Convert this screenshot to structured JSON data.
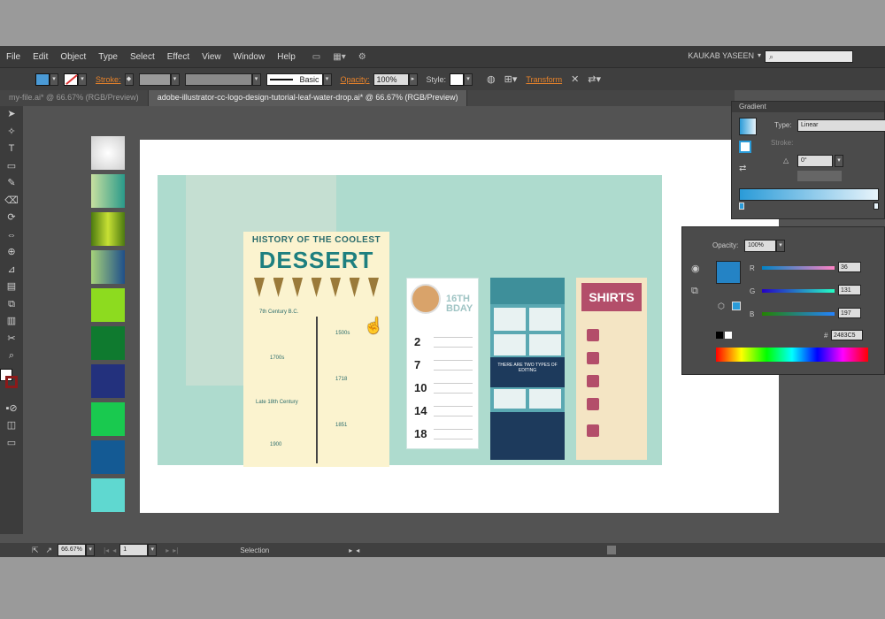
{
  "menu": {
    "items": [
      "File",
      "Edit",
      "Object",
      "Type",
      "Select",
      "Effect",
      "View",
      "Window",
      "Help"
    ],
    "user": "KAUKAB YASEEN",
    "search_placeholder": ""
  },
  "options": {
    "stroke_label": "Stroke:",
    "basic_label": "Basic",
    "opacity_label": "Opacity:",
    "opacity_value": "100%",
    "style_label": "Style:",
    "transform_label": "Transform"
  },
  "tabs": [
    {
      "label": "my-file.ai* @ 66.67% (RGB/Preview)",
      "active": false
    },
    {
      "label": "adobe-illustrator-cc-logo-design-tutorial-leaf-water-drop.ai* @ 66.67% (RGB/Preview)",
      "active": true
    }
  ],
  "tools": [
    "selection-tool",
    "direct-selection-tool",
    "type-tool",
    "rectangle-tool",
    "pen-tool",
    "pencil-tool",
    "rotate-tool",
    "scale-tool",
    "width-tool",
    "free-transform-tool",
    "shape-builder-tool",
    "perspective-tool",
    "mesh-tool",
    "gradient-tool",
    "eyedropper-tool",
    "blend-tool",
    "symbol-tool",
    "graph-tool",
    "artboard-tool",
    "slice-tool",
    "hand-tool",
    "zoom-tool"
  ],
  "swatches": [
    "#e9e9e9",
    "#8fd08a",
    "#7fb81f",
    "#2a9a8a",
    "#8ddb1f",
    "#0f7a2f",
    "#23317d",
    "#19c94f",
    "#145a94",
    "#5fd8d0"
  ],
  "artwork": {
    "dessert": {
      "title": "HISTORY OF THE COOLEST",
      "big": "DESSERT",
      "labels": [
        "7th Century B.C.",
        "1500s",
        "1700s",
        "1718",
        "Late 18th Century",
        "1851",
        "1900"
      ]
    },
    "bday": {
      "line1": "",
      "line2": "16TH BDAY",
      "numbers": [
        "2",
        "7",
        "10",
        "14",
        "18"
      ]
    },
    "navy": {
      "header": "",
      "mid": "THERE ARE TWO TYPES OF EDITING"
    },
    "shirts": {
      "banner": "SHIRTS"
    }
  },
  "status": {
    "zoom": "66.67%",
    "page": "1",
    "tool": "Selection"
  },
  "gradient_panel": {
    "title": "Gradient",
    "type_label": "Type:",
    "type_value": "Linear",
    "stroke_label": "Stroke:",
    "angle_value": "0°",
    "start_color": "#2a9bd8",
    "end_color": "#e8f4fb"
  },
  "color_panel": {
    "opacity_label": "Opacity:",
    "opacity_value": "100%",
    "r_label": "R",
    "r_value": "36",
    "g_label": "G",
    "g_value": "131",
    "b_label": "B",
    "b_value": "197",
    "hex_label": "#",
    "hex_value": "2483C5",
    "fill_color": "#2483c5"
  }
}
